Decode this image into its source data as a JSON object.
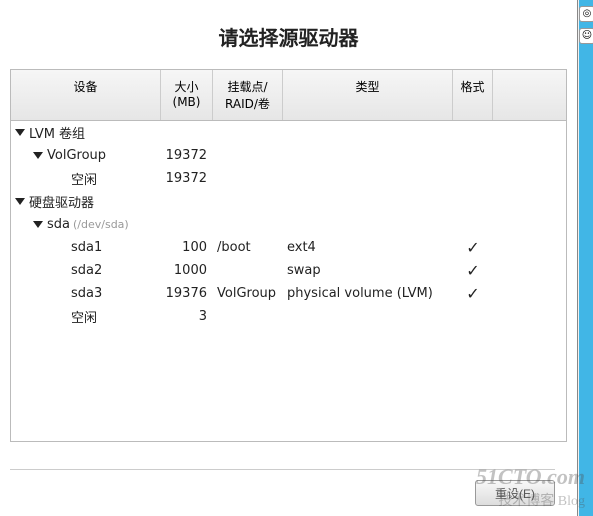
{
  "title": "请选择源驱动器",
  "columns": {
    "device": "设备",
    "size": "大小\n(MB)",
    "mount": "挂载点/\nRAID/卷",
    "type": "类型",
    "format": "格式"
  },
  "rows": [
    {
      "indent": 1,
      "expand": true,
      "device": "LVM 卷组",
      "size": "",
      "mount": "",
      "type": "",
      "format": false
    },
    {
      "indent": 2,
      "expand": true,
      "device": "VolGroup",
      "size": "19372",
      "mount": "",
      "type": "",
      "format": false
    },
    {
      "indent": 4,
      "expand": false,
      "device": "空闲",
      "size": "19372",
      "mount": "",
      "type": "",
      "format": false
    },
    {
      "indent": 1,
      "expand": true,
      "device": "硬盘驱动器",
      "size": "",
      "mount": "",
      "type": "",
      "format": false
    },
    {
      "indent": 2,
      "expand": true,
      "device": "sda",
      "devnote": "(/dev/sda)",
      "size": "",
      "mount": "",
      "type": "",
      "format": false
    },
    {
      "indent": 4,
      "expand": false,
      "device": "sda1",
      "size": "100",
      "mount": "/boot",
      "type": "ext4",
      "format": true
    },
    {
      "indent": 4,
      "expand": false,
      "device": "sda2",
      "size": "1000",
      "mount": "",
      "type": "swap",
      "format": true
    },
    {
      "indent": 4,
      "expand": false,
      "device": "sda3",
      "size": "19376",
      "mount": "VolGroup",
      "type": "physical volume (LVM)",
      "format": true
    },
    {
      "indent": 4,
      "expand": false,
      "device": "空闲",
      "size": "3",
      "mount": "",
      "type": "",
      "format": false
    }
  ],
  "buttons": {
    "reset": "重设(E)"
  },
  "watermark": {
    "line1": "51CTO.com",
    "line2": "技术博客  Blog"
  }
}
